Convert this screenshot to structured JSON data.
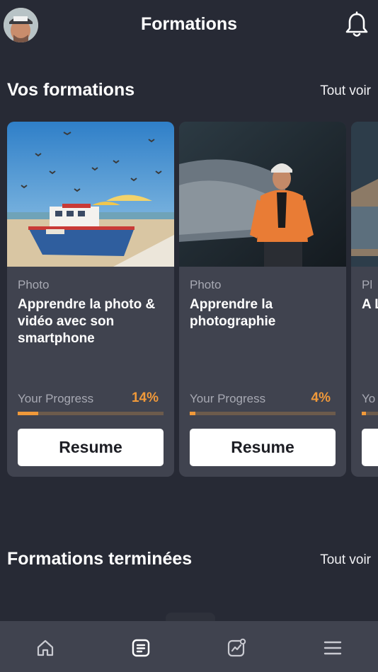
{
  "header": {
    "title": "Formations",
    "avatar_icon": "user-avatar",
    "notifications_icon": "bell-icon"
  },
  "sections": {
    "ongoing": {
      "title": "Vos formations",
      "see_all": "Tout voir"
    },
    "finished": {
      "title": "Formations terminées",
      "see_all": "Tout voir"
    }
  },
  "courses": [
    {
      "category": "Photo",
      "title": "Apprendre la photo & vidéo avec son smartphone",
      "progress_label": "Your Progress",
      "progress_text": "14%",
      "progress": 0.14,
      "button": "Resume"
    },
    {
      "category": "Photo",
      "title": "Apprendre la photographie",
      "progress_label": "Your Progress",
      "progress_text": "4%",
      "progress": 0.04,
      "button": "Resume"
    },
    {
      "category": "Pl",
      "title": "A Li",
      "progress_label": "Yo",
      "progress": 0.03
    }
  ],
  "tabbar": {
    "items": [
      {
        "name": "home",
        "icon": "home-icon"
      },
      {
        "name": "courses",
        "icon": "document-icon",
        "active": true
      },
      {
        "name": "stats",
        "icon": "chart-icon"
      },
      {
        "name": "menu",
        "icon": "hamburger-icon"
      }
    ]
  },
  "colors": {
    "background": "#272a35",
    "card": "#40434f",
    "accent": "#f0993a",
    "muted_text": "#a7a9b3"
  }
}
